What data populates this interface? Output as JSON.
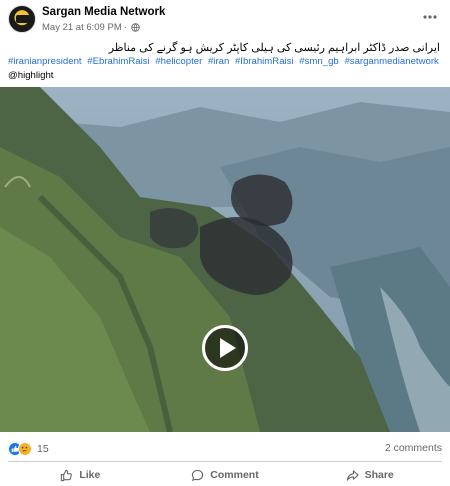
{
  "post": {
    "author": "Sargan Media Network",
    "date": "May 21 at 6:09 PM",
    "separator": "·",
    "caption_urdu": "ایرانی صدر ڈاکٹر ابراہیم رئیسی کی ہیلی کاپٹر کریش ہو گرنے کی مناظر",
    "hashtags": [
      "#iranianpresident",
      "#EbrahimRaisi",
      "#helicopter",
      "#iran",
      "#IbrahimRaisi",
      "#smn_gb",
      "#sarganmedianetwork"
    ],
    "mention": "@highlight"
  },
  "stats": {
    "reaction_count": "15",
    "comments": "2 comments"
  },
  "actions": {
    "like": "Like",
    "comment": "Comment",
    "share": "Share"
  },
  "icons": {
    "globe": "globe-icon",
    "more": "more-options-icon",
    "play": "play-icon",
    "like_reaction": "like-reaction-icon",
    "sad_reaction": "sad-reaction-icon",
    "like": "thumbs-up-icon",
    "comment": "comment-bubble-icon",
    "share": "share-arrow-icon"
  },
  "colors": {
    "link": "#216fdb",
    "muted": "#65676b",
    "like_blue": "#1877f2"
  }
}
